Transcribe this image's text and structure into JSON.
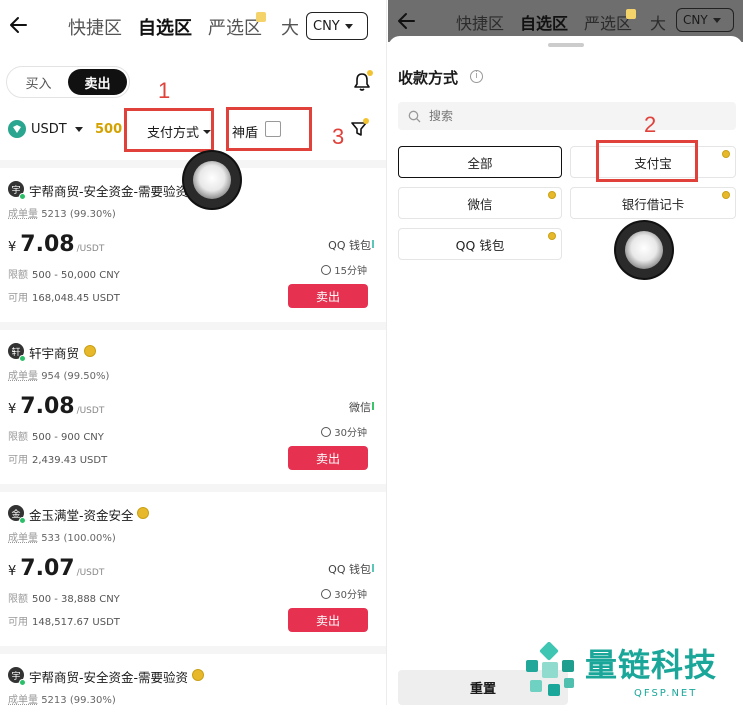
{
  "nav": {
    "tabs": [
      {
        "label": "快捷区"
      },
      {
        "label": "自选区"
      },
      {
        "label": "严选区"
      },
      {
        "label": "大"
      }
    ],
    "currency": "CNY"
  },
  "trade": {
    "buy_label": "买入",
    "sell_label": "卖出"
  },
  "filters": {
    "asset": "USDT",
    "amount": "500",
    "payment_label": "支付方式",
    "shield_label": "神盾"
  },
  "annotations": [
    "1",
    "2",
    "3"
  ],
  "listings": [
    {
      "merchant": "宇帮商贸-安全资金-需要验资",
      "avatar": "宇",
      "stats_label": "成单量",
      "trades": "5213",
      "rate": "(99.30%)",
      "currency_sign": "¥",
      "price": "7.08",
      "unit": "/USDT",
      "limit_label": "限额",
      "limit": "500 - 50,000 CNY",
      "avail_label": "可用",
      "available": "168,048.45 USDT",
      "pay_method": "QQ 钱包",
      "time": "15分钟",
      "action": "卖出",
      "verified": false
    },
    {
      "merchant": "轩宇商贸",
      "avatar": "轩",
      "stats_label": "成单量",
      "trades": "954",
      "rate": "(99.50%)",
      "currency_sign": "¥",
      "price": "7.08",
      "unit": "/USDT",
      "limit_label": "限额",
      "limit": "500 - 900 CNY",
      "avail_label": "可用",
      "available": "2,439.43 USDT",
      "pay_method": "微信",
      "time": "30分钟",
      "action": "卖出",
      "verified": true
    },
    {
      "merchant": "金玉满堂-资金安全",
      "avatar": "金",
      "stats_label": "成单量",
      "trades": "533",
      "rate": "(100.00%)",
      "currency_sign": "¥",
      "price": "7.07",
      "unit": "/USDT",
      "limit_label": "限额",
      "limit": "500 - 38,888 CNY",
      "avail_label": "可用",
      "available": "148,517.67 USDT",
      "pay_method": "QQ 钱包",
      "time": "30分钟",
      "action": "卖出",
      "verified": true
    },
    {
      "merchant": "宇帮商贸-安全资金-需要验资",
      "avatar": "宇",
      "stats_label": "成单量",
      "trades": "5213",
      "rate": "(99.30%)",
      "verified": true
    }
  ],
  "sheet": {
    "title": "收款方式",
    "search_placeholder": "搜索",
    "options": [
      {
        "label": "全部"
      },
      {
        "label": "支付宝"
      },
      {
        "label": "微信"
      },
      {
        "label": "银行借记卡"
      },
      {
        "label": "QQ 钱包"
      }
    ],
    "reset_label": "重置"
  },
  "watermark": {
    "text": "量链科技",
    "sub": "QFSP.NET"
  },
  "colors": {
    "sell": "#e63250",
    "annotation": "#e0413a",
    "accent_teal": "#1aa79a",
    "gold": "#e7b92a"
  }
}
